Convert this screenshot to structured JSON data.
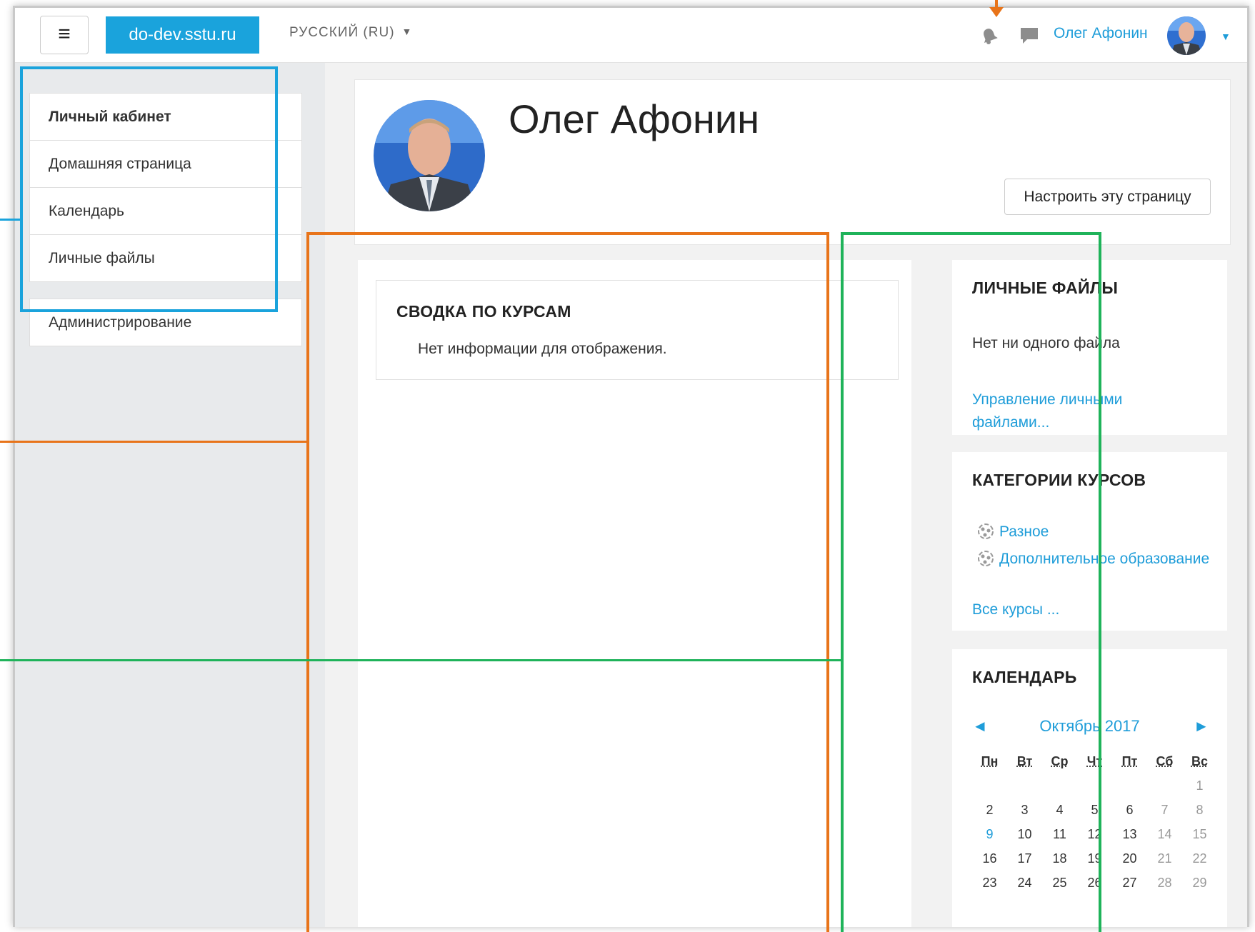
{
  "header": {
    "menu_icon": "hamburger-icon",
    "site_name": "do-dev.sstu.ru",
    "language": "РУССКИЙ (RU)",
    "user_name": "Олег Афонин",
    "icons": [
      "bell-icon",
      "chat-icon"
    ]
  },
  "sidebar": {
    "items": [
      {
        "label": "Личный кабинет"
      },
      {
        "label": "Домашняя страница"
      },
      {
        "label": "Календарь"
      },
      {
        "label": "Личные файлы"
      }
    ],
    "admin": {
      "label": "Администрирование"
    }
  },
  "profile": {
    "name": "Олег Афонин",
    "customise_button": "Настроить эту страницу"
  },
  "course_overview": {
    "title": "СВОДКА ПО КУРСАМ",
    "empty_text": "Нет информации для отображения."
  },
  "private_files": {
    "title": "ЛИЧНЫЕ ФАЙЛЫ",
    "empty_text": "Нет ни одного файла",
    "manage_link": "Управление личными файлами..."
  },
  "course_categories": {
    "title": "КАТЕГОРИИ КУРСОВ",
    "items": [
      {
        "label": "Разное"
      },
      {
        "label": "Дополнительное образование"
      }
    ],
    "all_courses": "Все курсы ..."
  },
  "calendar": {
    "title": "КАЛЕНДАРЬ",
    "month": "Октябрь 2017",
    "prev": "◄",
    "next": "►",
    "weekdays": [
      "Пн",
      "Вт",
      "Ср",
      "Чт",
      "Пт",
      "Сб",
      "Вс"
    ],
    "weeks": [
      [
        "",
        "",
        "",
        "",
        "",
        "",
        "1"
      ],
      [
        "2",
        "3",
        "4",
        "5",
        "6",
        "7",
        "8"
      ],
      [
        "9",
        "10",
        "11",
        "12",
        "13",
        "14",
        "15"
      ],
      [
        "16",
        "17",
        "18",
        "19",
        "20",
        "21",
        "22"
      ],
      [
        "23",
        "24",
        "25",
        "26",
        "27",
        "28",
        "29"
      ]
    ],
    "today": "9"
  },
  "annotation_colors": {
    "blue": "#1aa3dc",
    "orange": "#e8741a",
    "green": "#1fb35a"
  }
}
